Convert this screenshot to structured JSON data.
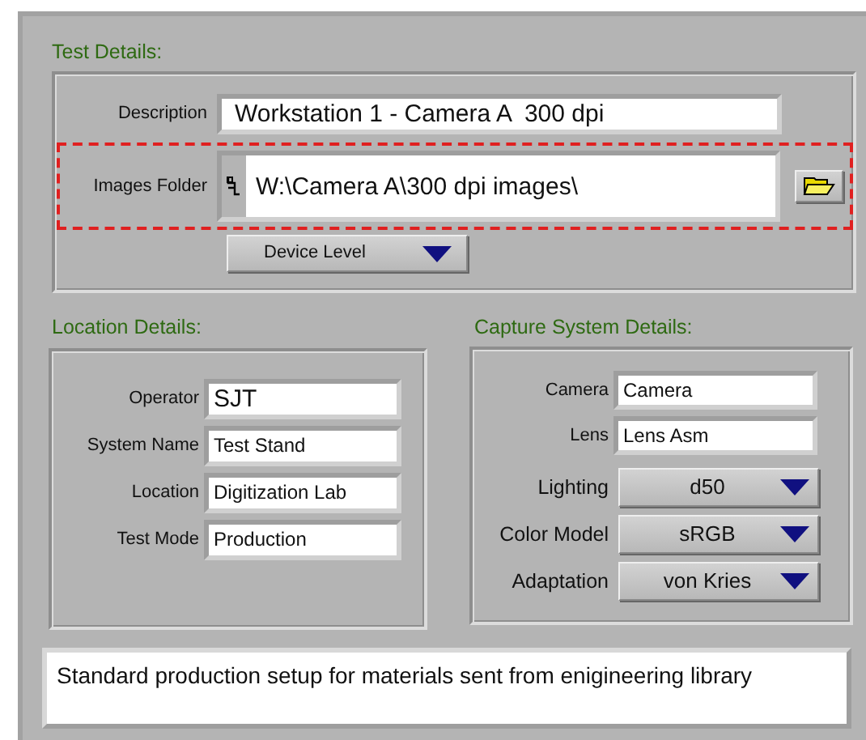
{
  "test_details": {
    "title": "Test Details:",
    "description": {
      "label": "Description",
      "value": "Workstation 1 - Camera A  300 dpi"
    },
    "images_folder": {
      "label": "Images Folder",
      "value": "W:\\Camera A\\300 dpi images\\",
      "highlighted": true
    },
    "device_level": {
      "value": "Device Level"
    }
  },
  "location_details": {
    "title": "Location Details:",
    "fields": [
      {
        "label": "Operator",
        "value": "SJT"
      },
      {
        "label": "System Name",
        "value": "Test Stand"
      },
      {
        "label": "Location",
        "value": "Digitization Lab"
      },
      {
        "label": "Test Mode",
        "value": "Production"
      }
    ]
  },
  "capture_system_details": {
    "title": "Capture System Details:",
    "fields": [
      {
        "kind": "text",
        "label": "Camera",
        "value": "Camera"
      },
      {
        "kind": "text",
        "label": "Lens",
        "value": "Lens Asm"
      },
      {
        "kind": "dropdown",
        "label": "Lighting",
        "value": "d50"
      },
      {
        "kind": "dropdown",
        "label": "Color Model",
        "value": "sRGB"
      },
      {
        "kind": "dropdown",
        "label": "Adaptation",
        "value": "von Kries"
      }
    ]
  },
  "notes": {
    "value": "Standard production setup for materials sent from enigineering library"
  }
}
